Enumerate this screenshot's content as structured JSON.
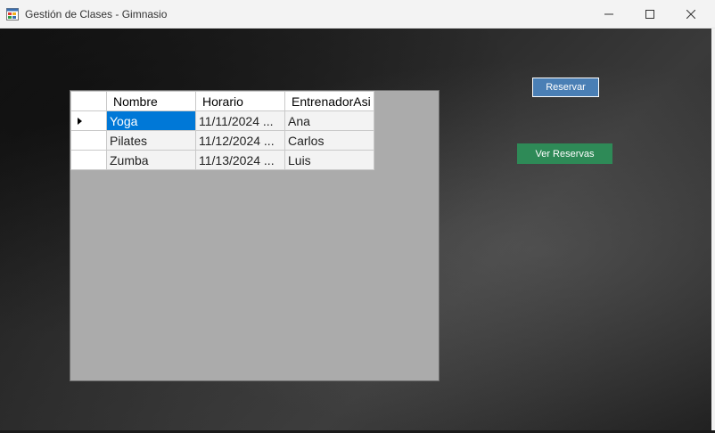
{
  "window": {
    "title": "Gestión de Clases - Gimnasio"
  },
  "grid": {
    "columns": [
      "Nombre",
      "Horario",
      "EntrenadorAsi"
    ],
    "rows": [
      {
        "nombre": "Yoga",
        "horario": "11/11/2024 ...",
        "entrenador": "Ana",
        "selected": true
      },
      {
        "nombre": "Pilates",
        "horario": "11/12/2024 ...",
        "entrenador": "Carlos",
        "selected": false
      },
      {
        "nombre": "Zumba",
        "horario": "11/13/2024 ...",
        "entrenador": "Luis",
        "selected": false
      }
    ]
  },
  "buttons": {
    "reservar": "Reservar",
    "ver_reservas": "Ver Reservas"
  },
  "colors": {
    "selection": "#0078d7",
    "reservar_button": "#4a7fb5",
    "ver_reservas_button": "#2e8a57",
    "grid_background": "#ababab"
  },
  "icons": {
    "app": "forms-app-icon",
    "minimize": "minimize-icon",
    "maximize": "maximize-icon",
    "close": "close-icon",
    "row_indicator": "row-pointer-icon"
  }
}
